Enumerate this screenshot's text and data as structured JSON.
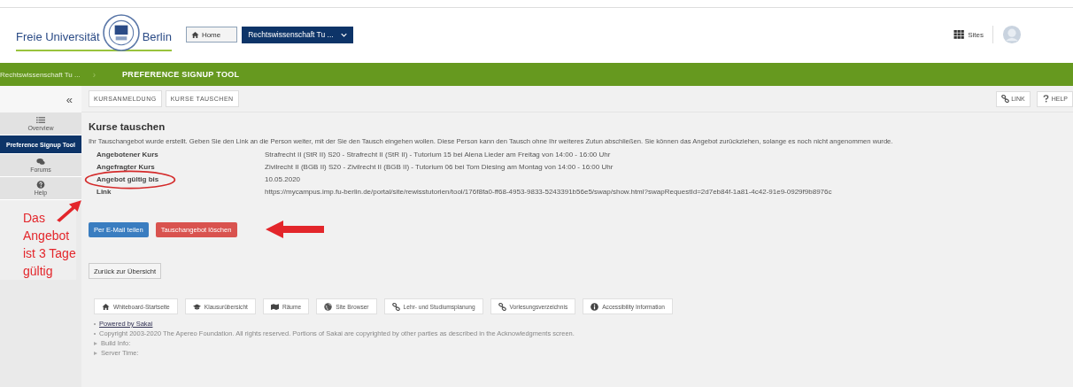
{
  "header": {
    "logo_left": "Freie Universität",
    "logo_right": "Berlin",
    "home_button": "Home",
    "site_menu": "Rechtswissenschaft Tu ...",
    "sites_link": "Sites"
  },
  "breadcrumb": {
    "site": "Rechtswissenschaft Tu ...",
    "separator": "›",
    "tool": "PREFERENCE SIGNUP TOOL"
  },
  "sidebar": {
    "collapse": "«",
    "items": [
      {
        "label": "Overview",
        "kind": "list",
        "selected": false
      },
      {
        "label": "Preference Signup Tool",
        "kind": "none",
        "selected": true
      },
      {
        "label": "Forums",
        "kind": "chat",
        "selected": false
      },
      {
        "label": "Help",
        "kind": "help",
        "selected": false
      }
    ]
  },
  "annotation": {
    "note": "Das Angebot ist 3 Tage gültig"
  },
  "tabs": [
    {
      "label": "KURSANMELDUNG",
      "selected": false
    },
    {
      "label": "KURSE TAUSCHEN",
      "selected": false
    }
  ],
  "tool_links": [
    {
      "label": "LINK",
      "kind": "link"
    },
    {
      "label": "HELP",
      "kind": "help"
    }
  ],
  "title": "Kurse tauschen",
  "message": "Ihr Tauschangebot wurde erstellt. Geben Sie den Link an die Person weiter, mit der Sie den Tausch eingehen wollen. Diese Person kann den Tausch ohne Ihr weiteres Zutun abschließen. Sie können das Angebot zurückziehen, solange es noch nicht angenommen wurde.",
  "details": [
    {
      "label": "Angebotener Kurs",
      "value": "Strafrecht II (StR II) S20 - Strafrecht II (StR II) - Tutorium 15 bei Alena Lieder am Freitag von 14:00 - 16:00 Uhr",
      "circled": false
    },
    {
      "label": "Angefragter Kurs",
      "value": "Zivilrecht II (BGB II) S20 - Zivilrecht II (BGB II) - Tutorium 06 bei Tom Diesing am Montag von 14:00 - 16:00 Uhr",
      "circled": false
    },
    {
      "label": "Angebot gültig bis",
      "value": "10.05.2020",
      "circled": true
    },
    {
      "label": "Link",
      "value": "https://mycampus.imp.fu-berlin.de/portal/site/rewisstutorien/tool/176f8fa0-ff68-4953-9833-5243391b56e5/swap/show.html?swapRequestId=2d7eb84f-1a81-4c42-91e9-0929f9b8976c",
      "circled": false
    }
  ],
  "actions": [
    {
      "label": "Per E-Mail teilen",
      "kind": "primary"
    },
    {
      "label": "Tauschangebot löschen",
      "kind": "danger"
    }
  ],
  "back_button": "Zurück zur Übersicht",
  "footer_nav": [
    {
      "label": "Whiteboard-Startseite",
      "kind": "home"
    },
    {
      "label": "Klausurübersicht",
      "kind": "cap"
    },
    {
      "label": "Räume",
      "kind": "map"
    },
    {
      "label": "Site Browser",
      "kind": "globe"
    },
    {
      "label": "Lehr- und Studiumsplanung",
      "kind": "link"
    },
    {
      "label": "Vorlesungsverzeichnis",
      "kind": "link"
    },
    {
      "label": "Accessibility Information",
      "kind": "info"
    }
  ],
  "footer": {
    "powered_by": "Powered by Sakai",
    "copyright": "Copyright 2003-2020 The Apereo Foundation. All rights reserved. Portions of Sakai are copyrighted by other parties as described in the Acknowledgments screen.",
    "build_info": "Build Info:",
    "server_time": "Server Time:"
  }
}
